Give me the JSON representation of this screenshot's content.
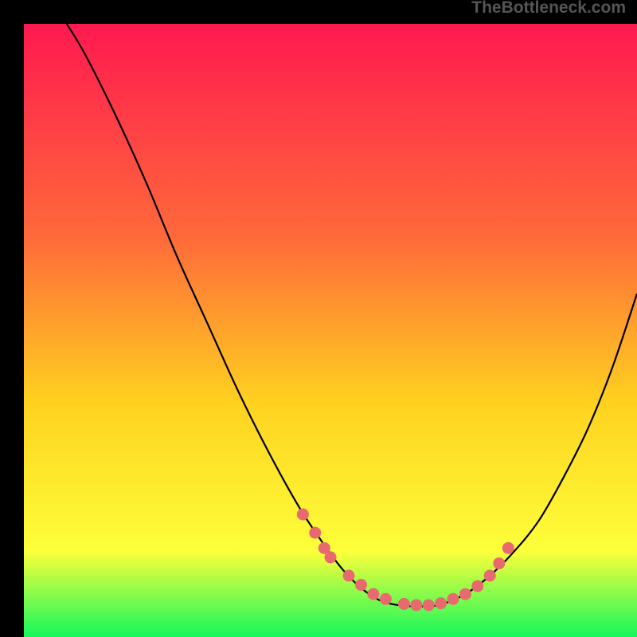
{
  "watermark": "TheBottleneck.com",
  "colors": {
    "gradient_top": "#ff1950",
    "gradient_mid1": "#ff6a3a",
    "gradient_mid2": "#ffd21f",
    "gradient_mid3": "#fdff3a",
    "gradient_bottom": "#14f75c",
    "curve": "#000000",
    "dots": "#e86a6f",
    "background": "#000000"
  },
  "chart_data": {
    "type": "line",
    "title": "",
    "xlabel": "",
    "ylabel": "",
    "xlim": [
      0,
      100
    ],
    "ylim": [
      0,
      100
    ],
    "curve": {
      "x": [
        7,
        10,
        15,
        20,
        25,
        30,
        35,
        40,
        45,
        49,
        52,
        55,
        58,
        61,
        65,
        68,
        72,
        76,
        80,
        84,
        88,
        92,
        96,
        100
      ],
      "y": [
        100,
        95,
        85,
        74,
        62,
        51,
        40,
        30,
        21,
        15,
        11,
        8,
        6,
        5.2,
        5,
        5.3,
        7,
        10,
        14,
        19,
        26,
        34,
        44,
        56
      ]
    },
    "series": [
      {
        "name": "markers",
        "x": [
          45.5,
          47.5,
          49,
          50,
          53,
          55,
          57,
          59,
          62,
          64,
          66,
          68,
          70,
          72,
          74,
          76,
          77.5,
          79
        ],
        "y": [
          20,
          17,
          14.5,
          13,
          10,
          8.5,
          7,
          6.2,
          5.4,
          5.2,
          5.2,
          5.5,
          6.2,
          7,
          8.3,
          10,
          12,
          14.5
        ]
      }
    ]
  }
}
